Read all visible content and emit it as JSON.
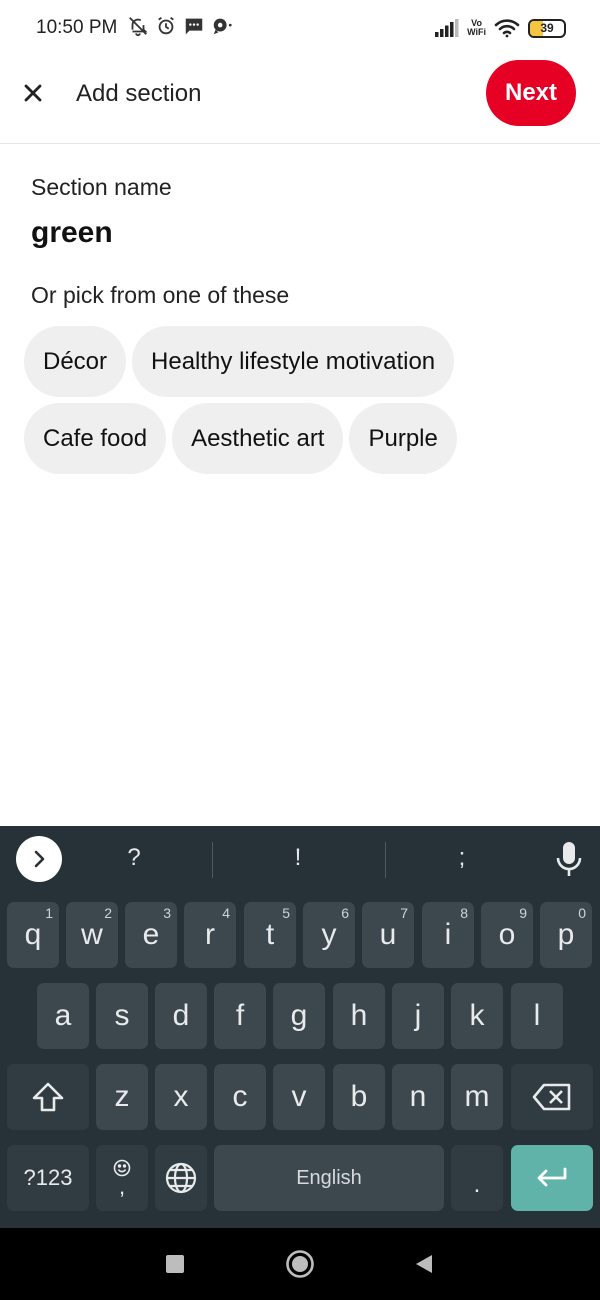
{
  "status_bar": {
    "time": "10:50 PM",
    "vowifi_line1": "Vo",
    "vowifi_line2": "WiFi",
    "battery_level": "39",
    "battery_fill_fraction": 0.39,
    "icons": [
      "bell-off-icon",
      "alarm-icon",
      "message-icon",
      "chat-bubble-icon",
      "signal-icon",
      "wifi-icon",
      "battery-icon"
    ]
  },
  "header": {
    "title": "Add section",
    "next_label": "Next",
    "accent_color": "#e60023"
  },
  "form": {
    "section_label": "Section name",
    "section_value": "green",
    "pick_label": "Or pick from one of these",
    "suggestions": [
      "Décor",
      "Healthy lifestyle motivation",
      "Cafe food",
      "Aesthetic art",
      "Purple"
    ]
  },
  "keyboard": {
    "suggestions": [
      "?",
      "!",
      ";"
    ],
    "row1": [
      {
        "key": "q",
        "hint": "1"
      },
      {
        "key": "w",
        "hint": "2"
      },
      {
        "key": "e",
        "hint": "3"
      },
      {
        "key": "r",
        "hint": "4"
      },
      {
        "key": "t",
        "hint": "5"
      },
      {
        "key": "y",
        "hint": "6"
      },
      {
        "key": "u",
        "hint": "7"
      },
      {
        "key": "i",
        "hint": "8"
      },
      {
        "key": "o",
        "hint": "9"
      },
      {
        "key": "p",
        "hint": "0"
      }
    ],
    "row2": [
      "a",
      "s",
      "d",
      "f",
      "g",
      "h",
      "j",
      "k",
      "l"
    ],
    "row3": [
      "z",
      "x",
      "c",
      "v",
      "b",
      "n",
      "m"
    ],
    "symbols_label": "?123",
    "comma": ",",
    "space_label": "English",
    "period": ".",
    "enter_color": "#5fb3a9"
  }
}
